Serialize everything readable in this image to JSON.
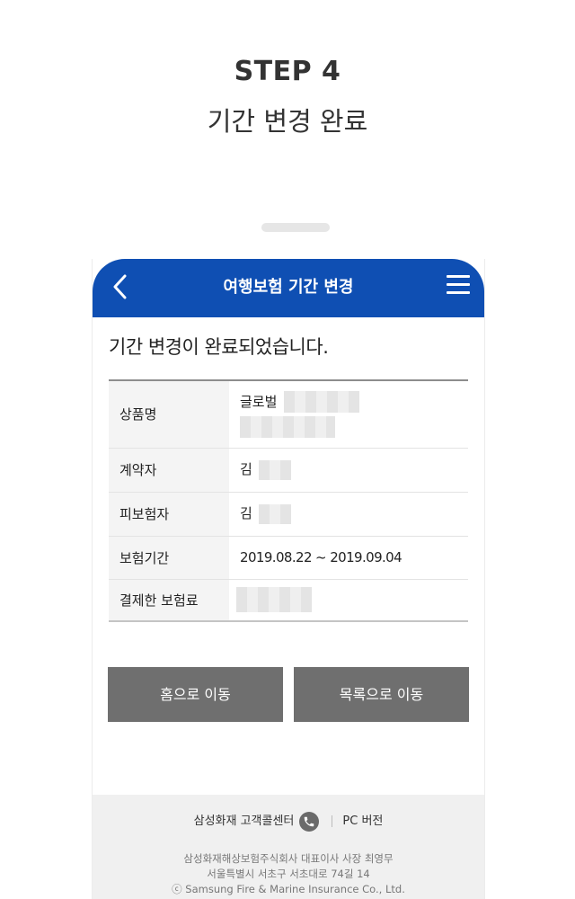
{
  "step": {
    "title": "STEP 4",
    "subtitle": "기간 변경 완료"
  },
  "app": {
    "title": "여행보험 기간 변경"
  },
  "message": "기간 변경이 완료되었습니다.",
  "info_rows": [
    {
      "label": "상품명",
      "value": "글로벌"
    },
    {
      "label": "계약자",
      "value": "김"
    },
    {
      "label": "피보험자",
      "value": "김"
    },
    {
      "label": "보험기간",
      "value": "2019.08.22 ~ 2019.09.04"
    },
    {
      "label": "결제한 보험료",
      "value": ""
    }
  ],
  "buttons": {
    "home": "홈으로 이동",
    "list": "목록으로 이동"
  },
  "footer": {
    "call_center": "삼성화재 고객콜센터",
    "pc_version": "PC 버전",
    "company": "삼성화재해상보험주식회사 대표이사 사장 최영무",
    "address": "서울특별시 서초구 서초대로 74길 14",
    "copyright": "ⓒ Samsung Fire & Marine Insurance Co., Ltd."
  },
  "colors": {
    "brand": "#0f4fb3",
    "button": "#6f6f6f",
    "footer_bg": "#f0f0f0"
  }
}
